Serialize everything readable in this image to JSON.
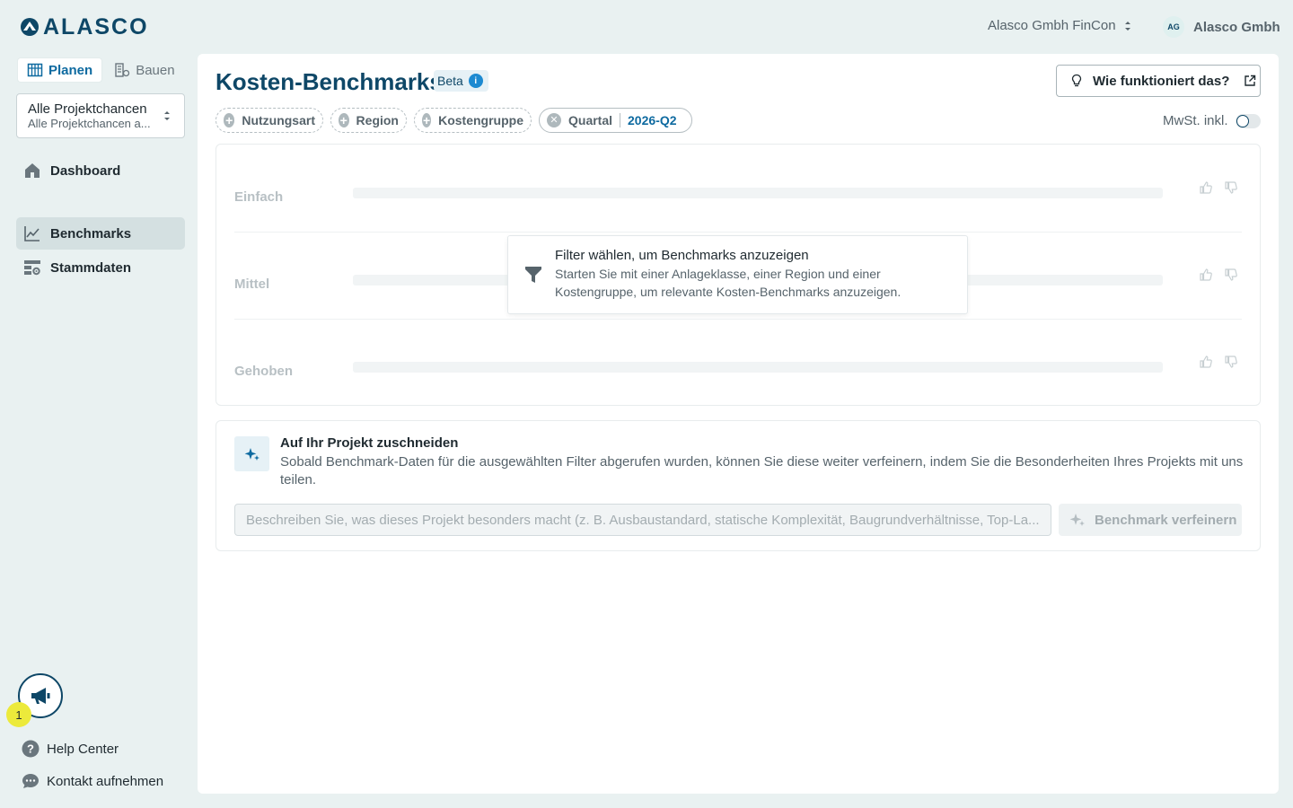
{
  "header": {
    "logo_text": "ALASCO",
    "org_switcher": "Alasco Gmbh FinCon",
    "user_initials": "AG",
    "user_name": "Alasco Gmbh"
  },
  "sidebar": {
    "modes": [
      {
        "label": "Planen",
        "active": true
      },
      {
        "label": "Bauen",
        "active": false
      }
    ],
    "project_select": {
      "title": "Alle Projektchancen",
      "subtitle": "Alle Projektchancen a..."
    },
    "nav": [
      {
        "label": "Dashboard",
        "icon": "home-icon",
        "active": false
      },
      {
        "label": "Benchmarks",
        "icon": "chart-line-icon",
        "active": true
      },
      {
        "label": "Stammdaten",
        "icon": "data-settings-icon",
        "active": false
      }
    ],
    "announcement_count": "1",
    "footer_links": [
      {
        "label": "Help Center",
        "icon": "help-icon"
      },
      {
        "label": "Kontakt aufnehmen",
        "icon": "chat-icon"
      }
    ]
  },
  "main": {
    "title": "Kosten-Benchmarks",
    "beta_label": "Beta",
    "how_button": "Wie funktioniert das?",
    "filters": [
      {
        "label": "Nutzungsart",
        "state": "add"
      },
      {
        "label": "Region",
        "state": "add"
      },
      {
        "label": "Kostengruppe",
        "state": "add"
      },
      {
        "label": "Quartal",
        "state": "set",
        "value": "2026-Q2"
      }
    ],
    "vat_label": "MwSt. inkl.",
    "vat_enabled": false,
    "benchmark_rows": [
      {
        "label": "Einfach"
      },
      {
        "label": "Mittel"
      },
      {
        "label": "Gehoben"
      }
    ],
    "empty_state": {
      "title": "Filter wählen, um Benchmarks anzuzeigen",
      "description": "Starten Sie mit einer Anlageklasse, einer Region und einer Kostengruppe, um relevante Kosten-Benchmarks anzuzeigen."
    },
    "refine": {
      "title": "Auf Ihr Projekt zuschneiden",
      "description": "Sobald Benchmark-Daten für die ausgewählten Filter abgerufen wurden, können Sie diese weiter verfeinern, indem Sie die Besonderheiten Ihres Projekts mit uns teilen.",
      "placeholder": "Beschreiben Sie, was dieses Projekt besonders macht (z. B. Ausbaustandard, statische Komplexität, Baugrundverhältnisse, Top-La...",
      "button_label": "Benchmark verfeinern"
    }
  },
  "colors": {
    "brand": "#0e4767",
    "accent": "#0e6aa0",
    "background": "#e9f1f1",
    "badge": "#ecea3b"
  }
}
